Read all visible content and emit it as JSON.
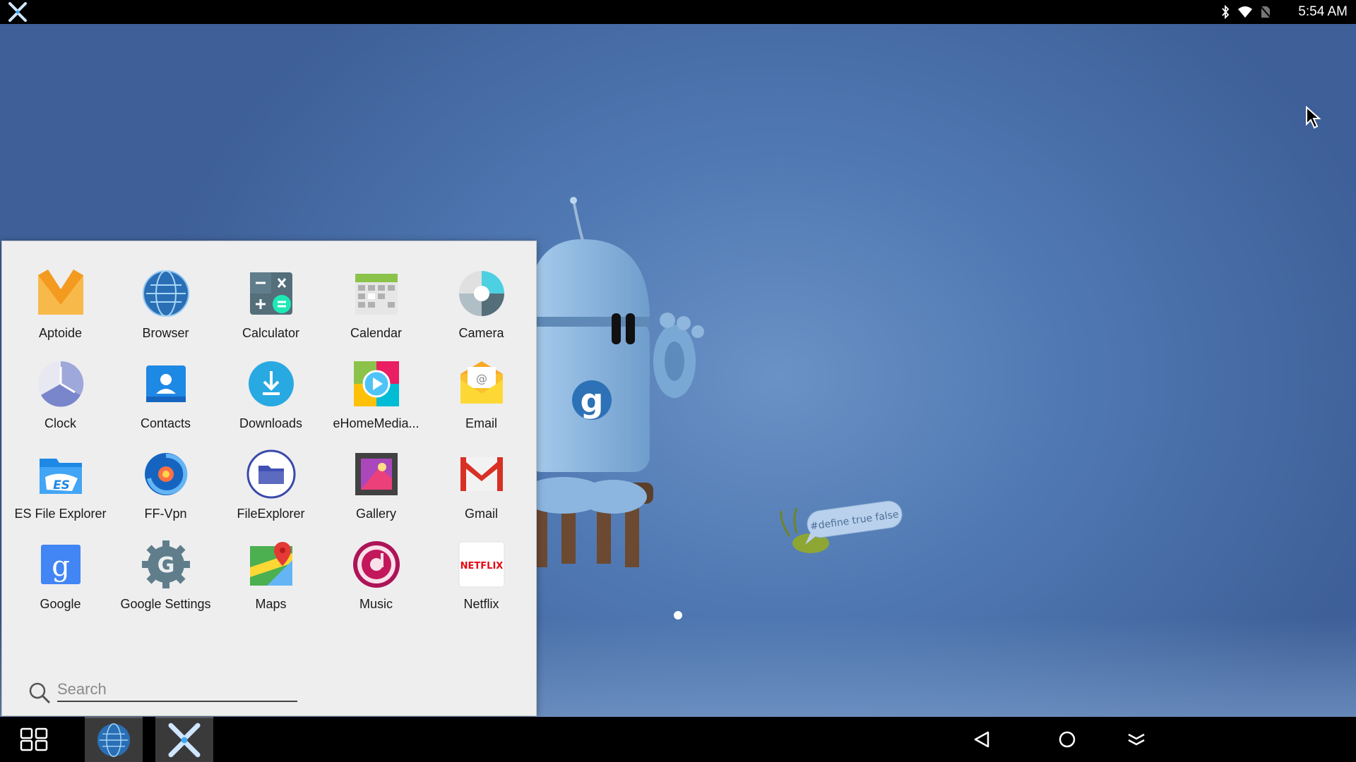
{
  "statusbar": {
    "clock": "5:54 AM",
    "icons": [
      "bluetooth-icon",
      "wifi-icon",
      "no-sim-icon"
    ]
  },
  "desktop": {
    "wallpaper_bubble_text": "#define true false",
    "robot_badge_letter": "g"
  },
  "drawer": {
    "apps": [
      {
        "label": "Aptoide",
        "icon": "aptoide-icon"
      },
      {
        "label": "Browser",
        "icon": "browser-globe-icon"
      },
      {
        "label": "Calculator",
        "icon": "calculator-icon"
      },
      {
        "label": "Calendar",
        "icon": "calendar-icon"
      },
      {
        "label": "Camera",
        "icon": "camera-icon"
      },
      {
        "label": "Clock",
        "icon": "clock-icon"
      },
      {
        "label": "Contacts",
        "icon": "contacts-icon"
      },
      {
        "label": "Downloads",
        "icon": "downloads-icon"
      },
      {
        "label": "eHomeMedia...",
        "icon": "ehomemedia-icon"
      },
      {
        "label": "Email",
        "icon": "email-icon"
      },
      {
        "label": "ES File Explorer",
        "icon": "es-file-explorer-icon"
      },
      {
        "label": "FF-Vpn",
        "icon": "ff-vpn-icon"
      },
      {
        "label": "FileExplorer",
        "icon": "file-explorer-icon"
      },
      {
        "label": "Gallery",
        "icon": "gallery-icon"
      },
      {
        "label": "Gmail",
        "icon": "gmail-icon"
      },
      {
        "label": "Google",
        "icon": "google-icon"
      },
      {
        "label": "Google Settings",
        "icon": "google-settings-icon"
      },
      {
        "label": "Maps",
        "icon": "maps-icon"
      },
      {
        "label": "Music",
        "icon": "music-icon"
      },
      {
        "label": "Netflix",
        "icon": "netflix-icon"
      }
    ],
    "search_placeholder": "Search",
    "search_value": "",
    "google_letter": "g",
    "google_settings_letter": "G",
    "es_letters": "ES",
    "netflix_wordmark": "NETFLIX"
  },
  "taskbar": {
    "running_apps": [
      "browser-globe-icon",
      "launcher-x-icon"
    ],
    "nav": [
      "back-icon",
      "home-icon",
      "collapse-icon"
    ]
  },
  "colors": {
    "statusbar": "#000000",
    "taskbar": "#000000",
    "drawer_bg": "#eeeeef",
    "wallpaper": "#5079b3"
  }
}
